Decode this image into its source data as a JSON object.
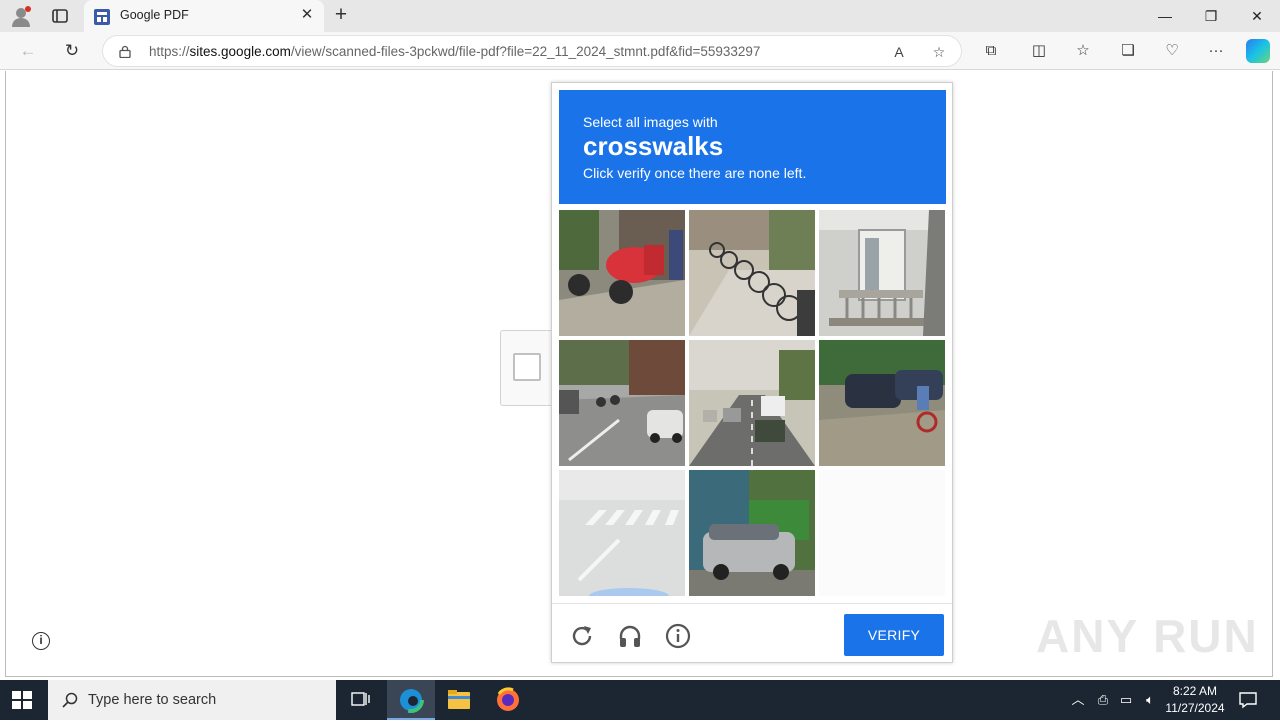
{
  "browser": {
    "tab_title": "Google PDF",
    "url_host": "sites.google.com",
    "url_path": "/view/scanned-files-3pckwd/file-pdf?file=22_11_2024_stmnt.pdf&fid=55933297",
    "url_scheme": "https://"
  },
  "captcha": {
    "instruction_line1": "Select all images with",
    "keyword": "crosswalks",
    "instruction_line3": "Click verify once there are none left.",
    "verify_label": "VERIFY",
    "accent_color": "#1a73e8",
    "tiles": [
      "red-scooter-sidewalk",
      "parked-bicycles",
      "building-balcony",
      "street-traffic-scooters",
      "road-traffic-cars",
      "parked-cars-cyclist",
      "faded-crosswalk",
      "silver-minivan-truck",
      "empty"
    ]
  },
  "watermark": "ANY RUN",
  "taskbar": {
    "search_placeholder": "Type here to search",
    "time": "8:22 AM",
    "date": "11/27/2024"
  }
}
